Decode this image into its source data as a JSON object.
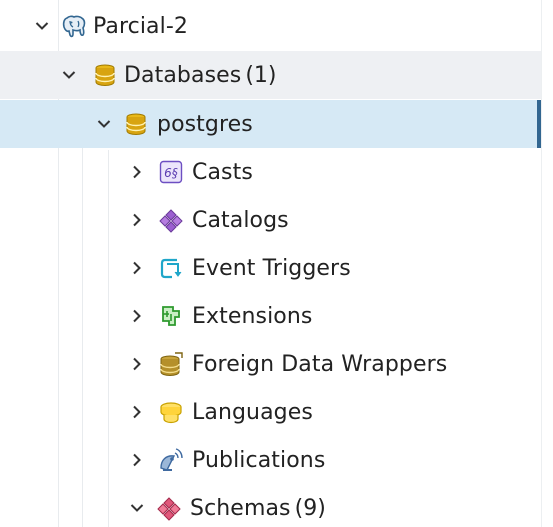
{
  "tree": {
    "server": {
      "label": "Parcial-2",
      "icon": "postgres-elephant-icon"
    },
    "databases": {
      "label": "Databases",
      "count": "(1)",
      "icon": "databases-icon"
    },
    "database": {
      "label": "postgres",
      "icon": "database-icon"
    },
    "children": [
      {
        "label": "Casts",
        "icon": "casts-icon"
      },
      {
        "label": "Catalogs",
        "icon": "catalogs-icon"
      },
      {
        "label": "Event Triggers",
        "icon": "event-triggers-icon"
      },
      {
        "label": "Extensions",
        "icon": "extensions-icon"
      },
      {
        "label": "Foreign Data Wrappers",
        "icon": "foreign-data-wrappers-icon"
      },
      {
        "label": "Languages",
        "icon": "languages-icon"
      },
      {
        "label": "Publications",
        "icon": "publications-icon"
      }
    ],
    "schemas": {
      "label": "Schemas",
      "count": "(9)",
      "icon": "schemas-icon"
    }
  },
  "colors": {
    "selected_bg": "#d6e9f5",
    "selected_border": "#326690",
    "hover_bg": "#eef0f3",
    "text": "#222222"
  }
}
